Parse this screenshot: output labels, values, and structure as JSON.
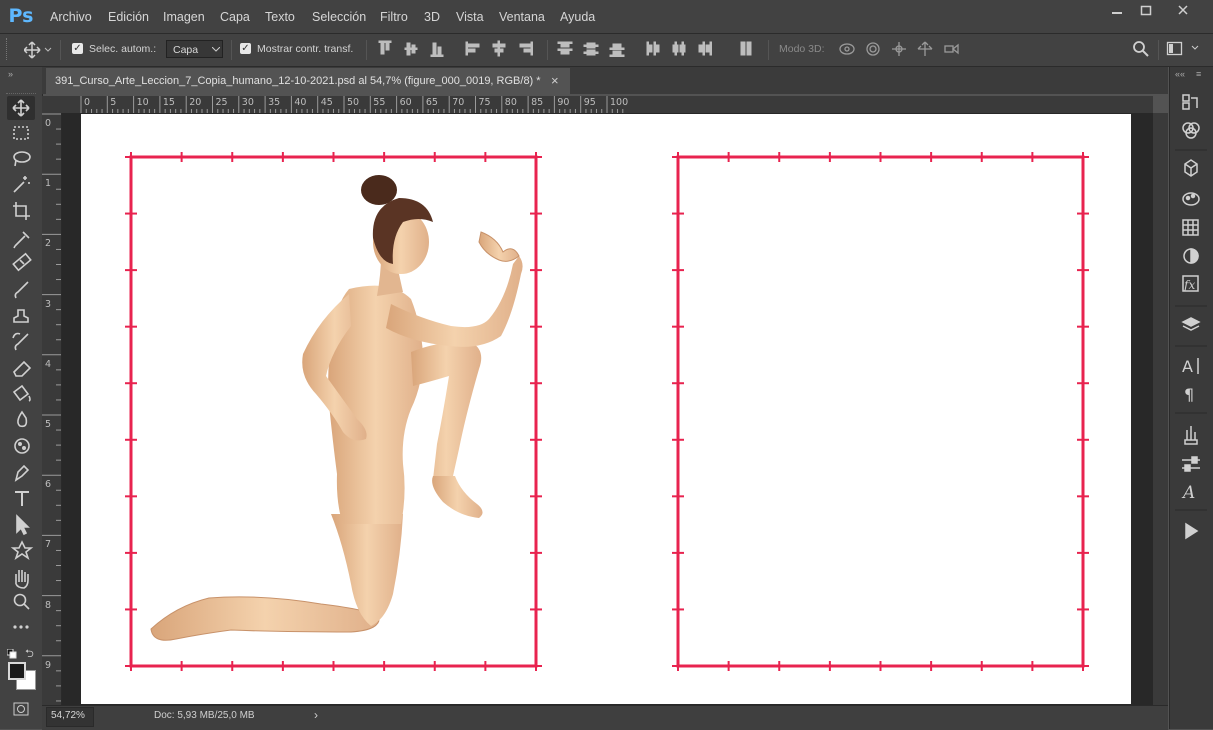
{
  "menubar": {
    "logo": "Ps",
    "items": [
      "Archivo",
      "Edición",
      "Imagen",
      "Capa",
      "Texto",
      "Selección",
      "Filtro",
      "3D",
      "Vista",
      "Ventana",
      "Ayuda"
    ]
  },
  "options": {
    "auto_select_label": "Selec. autom.:",
    "auto_select_checked": true,
    "layer_select_value": "Capa",
    "show_transform_label": "Mostrar contr. transf.",
    "show_transform_checked": true,
    "mode3d_label": "Modo 3D:"
  },
  "tab": {
    "title": "391_Curso_Arte_Leccion_7_Copia_humano_12-10-2021.psd al 54,7% (figure_000_0019, RGB/8) *",
    "close": "×"
  },
  "ruler": {
    "top_ticks": [
      "0",
      "5",
      "10",
      "15",
      "20",
      "25",
      "30",
      "35",
      "40",
      "45",
      "50",
      "55",
      "60",
      "65",
      "70",
      "75",
      "80",
      "85",
      "90",
      "95",
      "100"
    ],
    "left_ticks": [
      "0",
      "1",
      "2",
      "3",
      "4",
      "5",
      "6",
      "7",
      "8",
      "9"
    ]
  },
  "status": {
    "zoom": "54,72%",
    "doc": "Doc: 5,93 MB/25,0 MB",
    "arrow": "›"
  },
  "colors": {
    "frame": "#e8234f",
    "skin": "#f0c9a0",
    "hair": "#5a3424"
  },
  "icons": {
    "tools": [
      "move-icon",
      "marquee-icon",
      "lasso-icon",
      "magic-wand-icon",
      "crop-icon",
      "eyedropper-icon",
      "healing-brush-icon",
      "brush-icon",
      "clone-stamp-icon",
      "history-brush-icon",
      "eraser-icon",
      "paint-bucket-icon",
      "blur-icon",
      "dodge-icon",
      "pen-icon",
      "type-icon",
      "path-selection-icon",
      "shape-icon",
      "hand-icon",
      "zoom-icon",
      "more-tools-icon"
    ],
    "dock": [
      "history-icon",
      "adjustments-icon",
      "3d-icon",
      "styles-icon",
      "swatches-icon",
      "color-icon",
      "fx-icon",
      "layers-icon",
      "character-icon",
      "paragraph-icon",
      "brushes-icon",
      "brush-settings-icon",
      "glyphs-icon",
      "play-icon"
    ]
  }
}
